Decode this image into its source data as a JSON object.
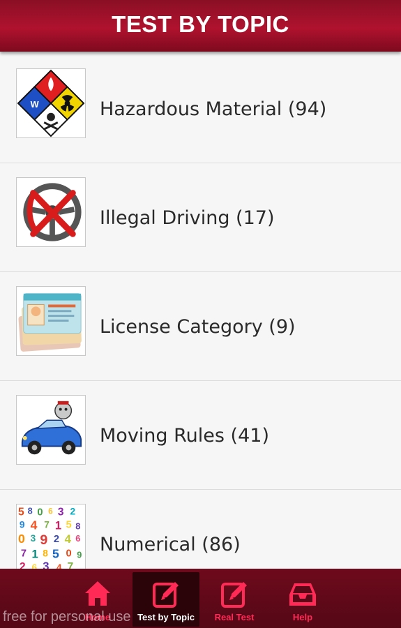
{
  "header": {
    "title": "TEST BY TOPIC"
  },
  "topics": [
    {
      "label": "Hazardous Material (94)",
      "icon": "hazard-diamond-icon"
    },
    {
      "label": "Illegal Driving (17)",
      "icon": "no-steering-wheel-icon"
    },
    {
      "label": "License Category (9)",
      "icon": "license-cards-icon"
    },
    {
      "label": "Moving Rules (41)",
      "icon": "cartoon-car-icon"
    },
    {
      "label": "Numerical (86)",
      "icon": "numbers-collage-icon"
    }
  ],
  "tabs": [
    {
      "label": "Home",
      "icon": "home-icon",
      "active": false
    },
    {
      "label": "Test by Topic",
      "icon": "edit-icon",
      "active": true
    },
    {
      "label": "Real Test",
      "icon": "edit-icon",
      "active": false
    },
    {
      "label": "Help",
      "icon": "inbox-icon",
      "active": false
    }
  ],
  "watermark": "free for personal use",
  "colors": {
    "header": "#a01029",
    "tabbar": "#5e0919",
    "tab_accent": "#ff2a55",
    "background": "#f6f6f6"
  }
}
